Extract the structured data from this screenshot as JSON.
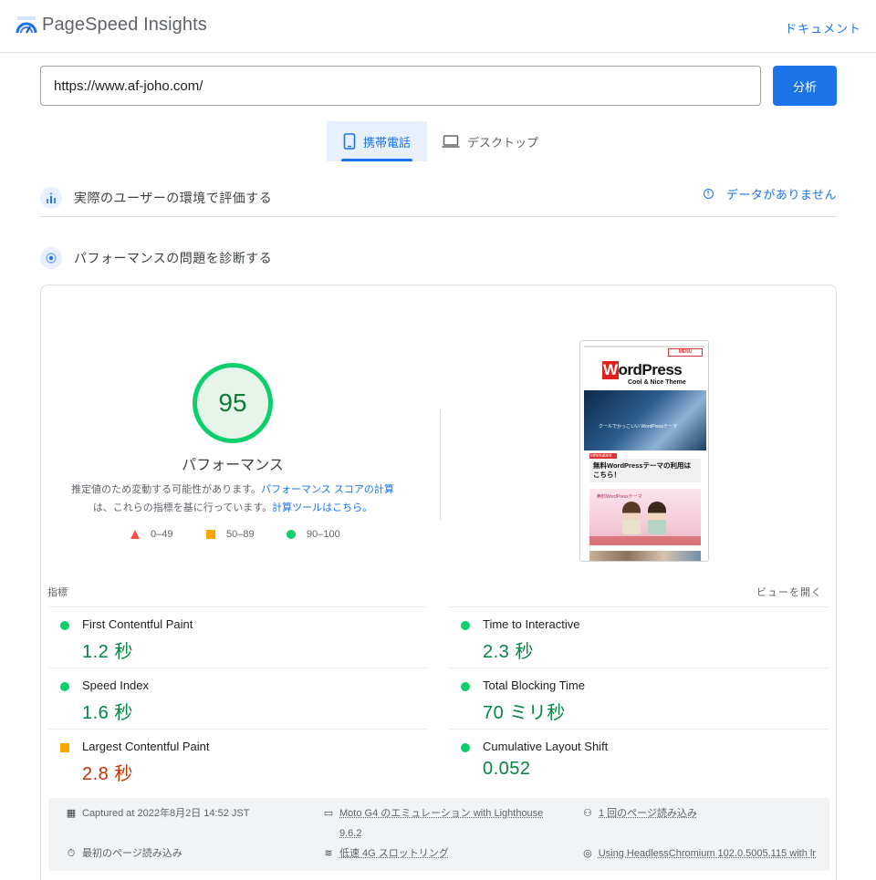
{
  "header": {
    "app_title": "PageSpeed Insights",
    "doc_link": "ドキュメント",
    "logo_icon": "pagespeed-logo-icon"
  },
  "search": {
    "url_value": "https://www.af-joho.com/",
    "analyze_label": "分析"
  },
  "tabs": [
    {
      "label": "携帯電話",
      "icon": "smartphone-icon",
      "selected": true
    },
    {
      "label": "デスクトップ",
      "icon": "laptop-icon",
      "selected": false
    }
  ],
  "field_section": {
    "title": "実際のユーザーの環境で評価する",
    "no_data": "データがありません"
  },
  "lab_section": {
    "title": "パフォーマンスの問題を診断する"
  },
  "score": {
    "value": "95",
    "label": "パフォーマンス",
    "desc_prefix": "推定値のため変動する可能性があります。",
    "desc_link1": "パフォーマンス スコアの計算",
    "desc_middle": "は、これらの指標を基に行っています。",
    "desc_link2": "計算ツールはこちら。"
  },
  "legend": [
    {
      "range": "0–49",
      "shape": "triangle",
      "color": "#ff4e42"
    },
    {
      "range": "50–89",
      "shape": "square",
      "color": "#ffa400"
    },
    {
      "range": "90–100",
      "shape": "circle",
      "color": "#0cce6b"
    }
  ],
  "screenshot": {
    "menu": "MENU",
    "logo_first": "W",
    "logo_rest": "ordPress",
    "logo_sub": "Cool & Nice Theme",
    "hero_text": "クールでかっこいい WordPressテーマ",
    "info_tag": "Infomation",
    "info_text": "無料WordPressテーマの利用は こちら！",
    "ad_title": "無料WordPressテーマ"
  },
  "metrics": {
    "header": "指標",
    "expand": "ビューを開く",
    "items": [
      {
        "name": "First Contentful Paint",
        "value": "1.2 秒",
        "status": "good"
      },
      {
        "name": "Time to Interactive",
        "value": "2.3 秒",
        "status": "good"
      },
      {
        "name": "Speed Index",
        "value": "1.6 秒",
        "status": "good"
      },
      {
        "name": "Total Blocking Time",
        "value": "70 ミリ秒",
        "status": "good"
      },
      {
        "name": "Largest Contentful Paint",
        "value": "2.8 秒",
        "status": "average"
      },
      {
        "name": "Cumulative Layout Shift",
        "value": "0.052",
        "status": "good"
      }
    ]
  },
  "footer": {
    "captured": "Captured at 2022年8月2日 14:52 JST",
    "device_line1": "Moto G4 のエミュレーション with Lighthouse",
    "device_line2": "9.6.2",
    "page_loads": "1 回のページ読み込み",
    "first_load": "最初のページ読み込み",
    "throttling": "低速 4G スロットリング",
    "browser": "Using HeadlessChromium 102.0.5005.115 with lr"
  },
  "colors": {
    "accent": "#1a73e8",
    "good": "#0cce6b",
    "average": "#ffa400",
    "poor": "#ff4e42"
  }
}
